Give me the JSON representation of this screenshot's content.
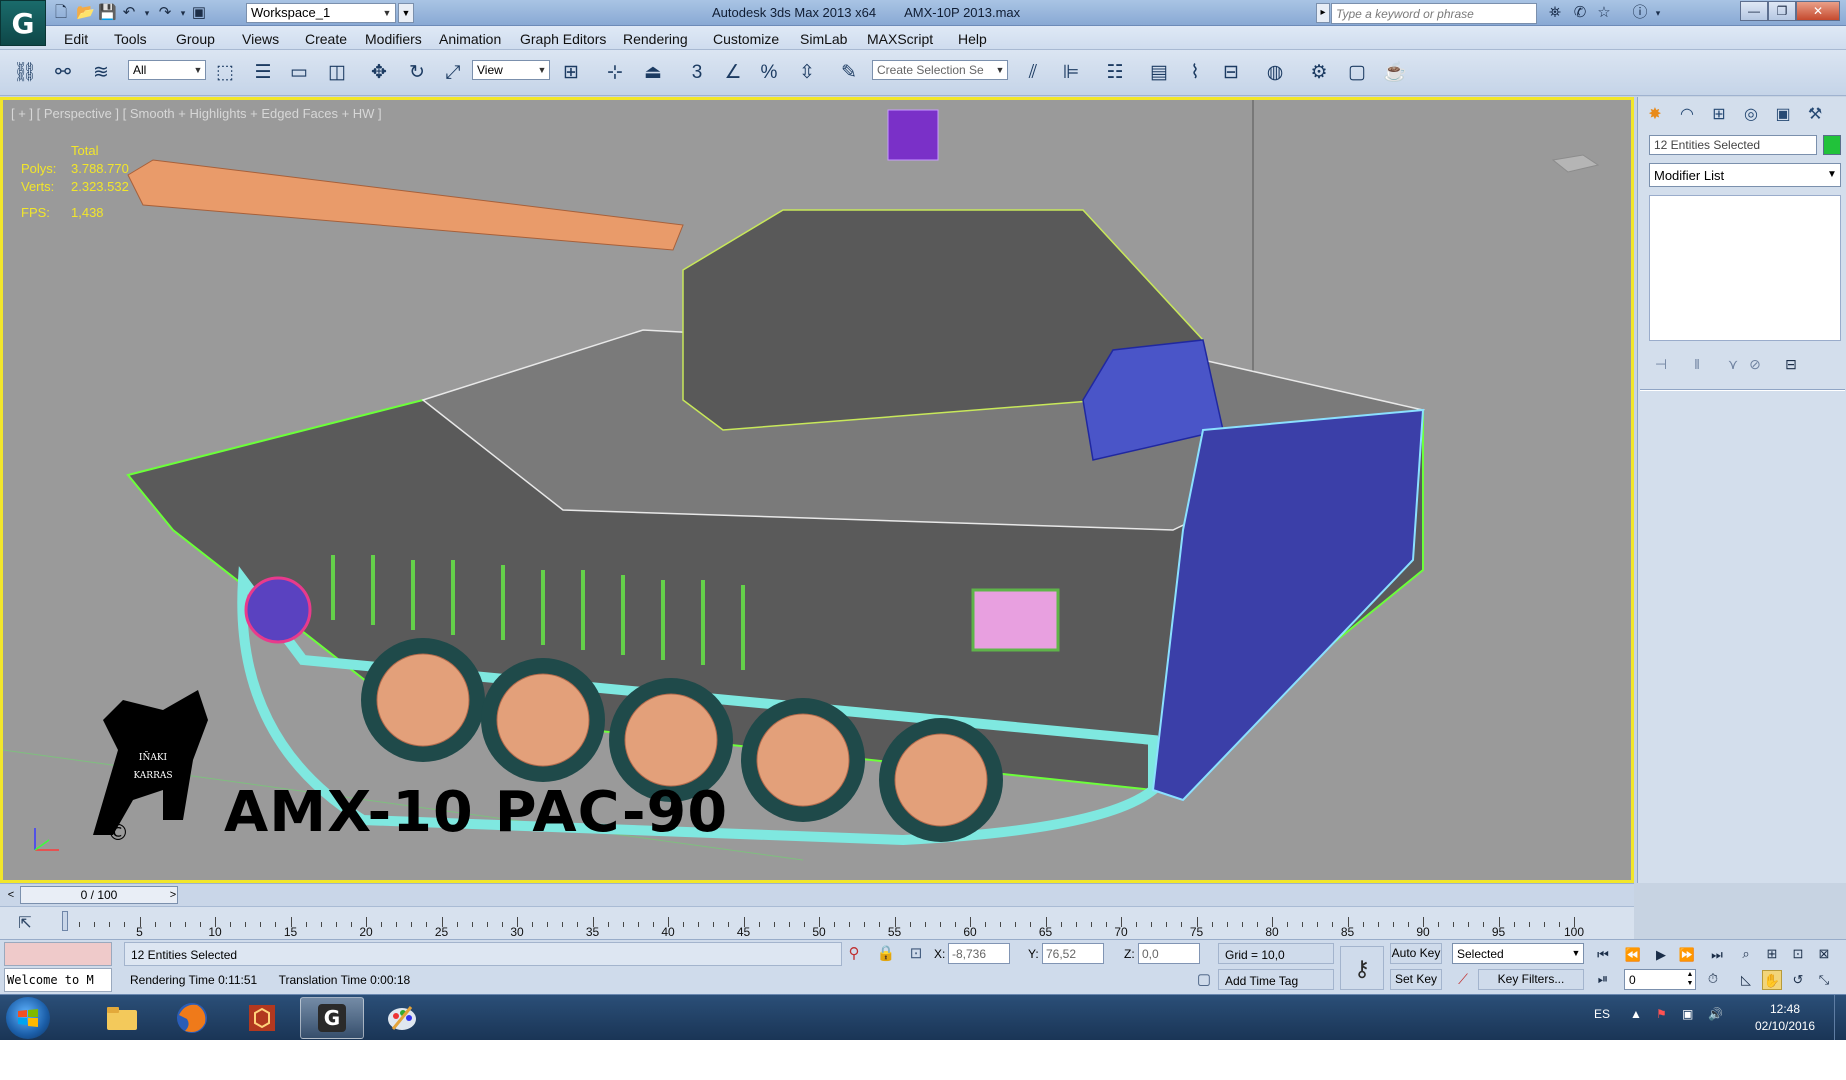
{
  "title_bar": {
    "workspace": "Workspace_1",
    "app_name": "Autodesk 3ds Max  2013 x64",
    "file_name": "AMX-10P 2013.max",
    "search_placeholder": "Type a keyword or phrase",
    "minimize": "—",
    "restore": "❐",
    "close": "✕"
  },
  "menu": [
    "Edit",
    "Tools",
    "Group",
    "Views",
    "Create",
    "Modifiers",
    "Animation",
    "Graph Editors",
    "Rendering",
    "Customize",
    "SimLab",
    "MAXScript",
    "Help"
  ],
  "toolbar": {
    "filter_value": "All",
    "ref_coord_value": "View",
    "named_selection_placeholder": "Create Selection Se",
    "snap_label": "3"
  },
  "viewport": {
    "label": "[ + ] [ Perspective ] [ Smooth + Highlights + Edged Faces + HW ]",
    "stats": {
      "header": "Total",
      "polys_label": "Polys:",
      "polys": "3.788.770",
      "verts_label": "Verts:",
      "verts": "2.323.532",
      "fps_label": "FPS:",
      "fps": "1,438"
    },
    "model_title": "AMX-10 PAC-90",
    "logo_text_1": "IÑAKI",
    "logo_text_2": "KARRAS",
    "logo_copyright": "©"
  },
  "command_panel": {
    "selection_field": "12 Entities Selected",
    "selection_color": "#21c23a",
    "modifier_list": "Modifier List"
  },
  "time_slider": {
    "value": "0 / 100",
    "prev": "<",
    "next": ">"
  },
  "track_bar": {
    "labels": [
      "5",
      "10",
      "15",
      "20",
      "25",
      "30",
      "35",
      "40",
      "45",
      "50",
      "55",
      "60",
      "65",
      "70",
      "75",
      "80",
      "85",
      "90",
      "95",
      "100"
    ]
  },
  "status_bar": {
    "maxscript_listener": "Welcome to M",
    "selection_status": "12 Entities Selected",
    "rendering_time_label": "Rendering Time",
    "rendering_time": "0:11:51",
    "translation_time_label": "Translation Time",
    "translation_time": "0:00:18",
    "x_label": "X:",
    "x_value": "-8,736",
    "y_label": "Y:",
    "y_value": "76,52",
    "z_label": "Z:",
    "z_value": "0,0",
    "grid": "Grid = 10,0",
    "add_time_tag": "Add Time Tag",
    "auto_key": "Auto Key",
    "set_key": "Set Key",
    "key_mode": "Selected",
    "key_filters": "Key Filters...",
    "current_frame": "0"
  },
  "taskbar": {
    "language": "ES",
    "time": "12:48",
    "date": "02/10/2016"
  }
}
